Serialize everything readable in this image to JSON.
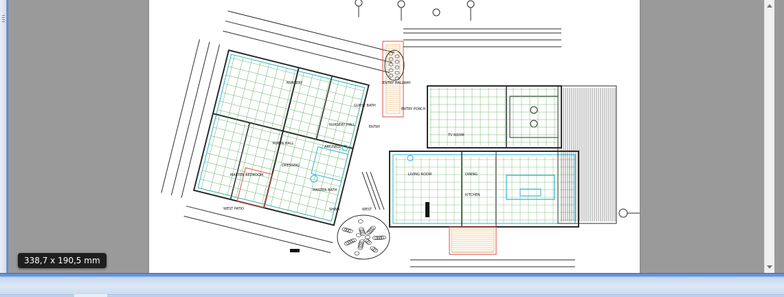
{
  "viewer": {
    "page_size_label": "338,7 x 190,5 mm"
  },
  "drawing": {
    "room_labels": [
      "NURSERY",
      "GUEST BATH",
      "ENTRY HALLWAY",
      "ENTRY PORCH",
      "NURSERY HALL",
      "ENTRY",
      "TV ROOM",
      "ART HALL",
      "ROBIN HALL",
      "DRESSING",
      "MASTER BEDROOM",
      "MASTER BATH",
      "LIVING ROOM",
      "DINING",
      "KITCHEN",
      "WEST PATIO",
      "WEST",
      "SHWR"
    ]
  },
  "colors": {
    "line": "#2a2a2a",
    "grid_green": "#5fb05f",
    "cyan": "#1fb6d6",
    "red": "#e04a4a",
    "orange": "#e59a3a",
    "page_bg": "#ffffff",
    "viewer_bg": "#9a9a9a"
  }
}
